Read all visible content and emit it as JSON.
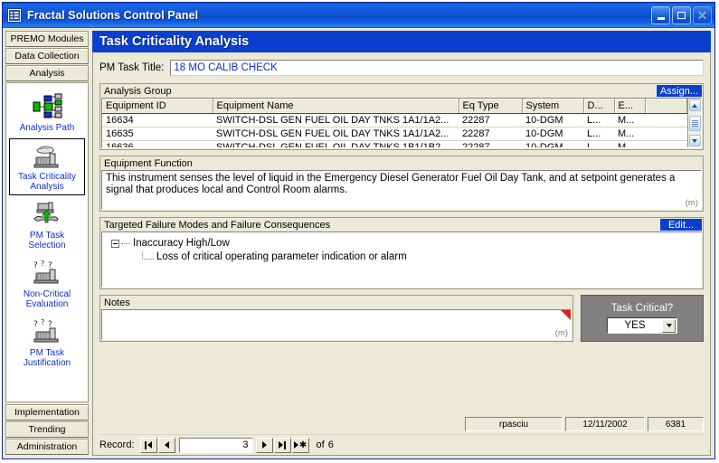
{
  "window": {
    "title": "Fractal Solutions Control Panel",
    "icon": "app-grid-icon",
    "buttons": {
      "minimize": "minimize-icon",
      "maximize": "maximize-icon",
      "close": "close-icon"
    }
  },
  "sidebar": {
    "top_tabs": [
      {
        "label": "PREMO Modules"
      },
      {
        "label": "Data Collection"
      },
      {
        "label": "Analysis"
      }
    ],
    "nav_items": [
      {
        "label": "Analysis Path",
        "icon": "analysis-path-icon",
        "selected": false
      },
      {
        "label": "Task Criticality\nAnalysis",
        "icon": "task-criticality-icon",
        "selected": true
      },
      {
        "label": "PM Task\nSelection",
        "icon": "pm-task-selection-icon",
        "selected": false
      },
      {
        "label": "Non-Critical\nEvaluation",
        "icon": "non-critical-evaluation-icon",
        "selected": false
      },
      {
        "label": "PM Task\nJustification",
        "icon": "pm-task-justification-icon",
        "selected": false
      }
    ],
    "bottom_tabs": [
      {
        "label": "Implementation"
      },
      {
        "label": "Trending"
      },
      {
        "label": "Administration"
      }
    ]
  },
  "page": {
    "header": "Task Criticality Analysis"
  },
  "task_title": {
    "label": "PM Task Title:",
    "value": "18 MO CALIB CHECK"
  },
  "analysis_group": {
    "caption": "Analysis Group",
    "button": "Assign...",
    "columns": [
      "Equipment ID",
      "Equipment Name",
      "Eq Type",
      "System",
      "D...",
      "E...",
      ""
    ],
    "rows": [
      [
        "16634",
        "SWITCH-DSL GEN FUEL OIL DAY TNKS 1A1/1A2...",
        "22287",
        "10-DGM",
        "L...",
        "M...",
        ""
      ],
      [
        "16635",
        "SWITCH-DSL GEN FUEL OIL DAY TNKS 1A1/1A2...",
        "22287",
        "10-DGM",
        "L...",
        "M...",
        ""
      ],
      [
        "16636",
        "SWITCH-DSL GEN FUEL OIL DAY TNKS 1B1/1B2...",
        "22287",
        "10-DGM",
        "L...",
        "M...",
        ""
      ]
    ]
  },
  "equipment_function": {
    "caption": "Equipment Function",
    "text": "This instrument senses the level of liquid in the Emergency Diesel Generator Fuel Oil Day Tank, and at setpoint generates a signal that produces local and Control Room alarms.",
    "memo_marker": "(m)"
  },
  "failure_modes": {
    "caption": "Targeted Failure Modes and Failure Consequences",
    "button": "Edit...",
    "parent": "Inaccuracy High/Low",
    "child": "Loss of critical operating parameter indication or alarm"
  },
  "notes": {
    "caption": "Notes",
    "value": "",
    "memo_marker": "(m)"
  },
  "task_critical": {
    "label": "Task Critical?",
    "value": "YES"
  },
  "status": {
    "user": "rpasciu",
    "date": "12/11/2002",
    "number": "6381"
  },
  "record_nav": {
    "label": "Record:",
    "current": "3",
    "of_label": "of",
    "total": "6",
    "buttons": [
      "first-record",
      "previous-record",
      "next-record",
      "last-record",
      "new-record"
    ]
  },
  "colors": {
    "titlebar": "#0b52d4",
    "header_blue": "#0a3fd0",
    "accent_link": "#0d2fd4",
    "face": "#ece9d8",
    "gray_panel": "#808080",
    "red_marker": "#e02020"
  }
}
